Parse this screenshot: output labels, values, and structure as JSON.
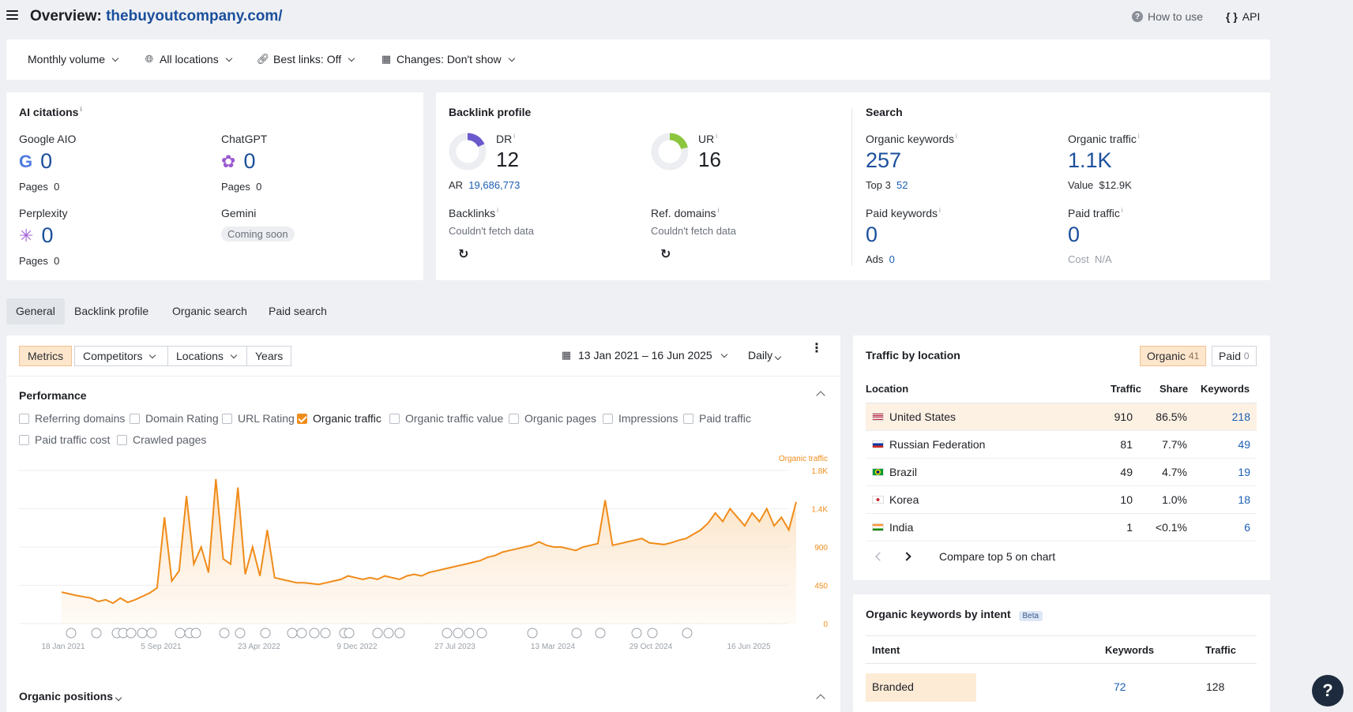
{
  "header": {
    "title_prefix": "Overview: ",
    "domain": "thebuyoutcompany.com/",
    "how_to_use": "How to use",
    "api": "API"
  },
  "filters": {
    "volume": "Monthly volume",
    "locations": "All locations",
    "best_links": "Best links: Off",
    "changes": "Changes: Don't show"
  },
  "ai_citations": {
    "title": "AI citations",
    "google": {
      "label": "Google AIO",
      "value": "0",
      "pages_label": "Pages",
      "pages": "0"
    },
    "chatgpt": {
      "label": "ChatGPT",
      "value": "0",
      "pages_label": "Pages",
      "pages": "0"
    },
    "perplexity": {
      "label": "Perplexity",
      "value": "0",
      "pages_label": "Pages",
      "pages": "0"
    },
    "gemini": {
      "label": "Gemini",
      "badge": "Coming soon"
    }
  },
  "backlink_profile": {
    "title": "Backlink profile",
    "dr_label": "DR",
    "dr": "12",
    "ar_label": "AR",
    "ar": "19,686,773",
    "ur_label": "UR",
    "ur": "16",
    "backlinks_label": "Backlinks",
    "backlinks_status": "Couldn't fetch data",
    "refdomains_label": "Ref. domains",
    "refdomains_status": "Couldn't fetch data"
  },
  "search": {
    "title": "Search",
    "organic_keywords_label": "Organic keywords",
    "organic_keywords": "257",
    "top3_label": "Top 3",
    "top3": "52",
    "organic_traffic_label": "Organic traffic",
    "organic_traffic": "1.1K",
    "value_label": "Value",
    "value": "$12.9K",
    "paid_keywords_label": "Paid keywords",
    "paid_keywords": "0",
    "ads_label": "Ads",
    "ads": "0",
    "paid_traffic_label": "Paid traffic",
    "paid_traffic": "0",
    "cost_label": "Cost",
    "cost": "N/A"
  },
  "tabs": [
    "General",
    "Backlink profile",
    "Organic search",
    "Paid search"
  ],
  "chart_controls": {
    "metrics": "Metrics",
    "competitors": "Competitors",
    "locations": "Locations",
    "years": "Years",
    "date_range": "13 Jan 2021 – 16 Jun 2025",
    "interval": "Daily"
  },
  "performance": {
    "title": "Performance",
    "checkboxes": [
      {
        "label": "Referring domains",
        "checked": false
      },
      {
        "label": "Domain Rating",
        "checked": false
      },
      {
        "label": "URL Rating",
        "checked": false
      },
      {
        "label": "Organic traffic",
        "checked": true
      },
      {
        "label": "Organic traffic value",
        "checked": false
      },
      {
        "label": "Organic pages",
        "checked": false
      },
      {
        "label": "Impressions",
        "checked": false
      },
      {
        "label": "Paid traffic",
        "checked": false
      },
      {
        "label": "Paid traffic cost",
        "checked": false
      },
      {
        "label": "Crawled pages",
        "checked": false
      }
    ]
  },
  "chart_data": {
    "type": "area",
    "series": [
      {
        "name": "Organic traffic",
        "color": "#f08c1a"
      }
    ],
    "y_ticks": [
      "1.8K",
      "1.4K",
      "900",
      "450",
      "0"
    ],
    "ylim": [
      0,
      1800
    ],
    "x_ticks": [
      "18 Jan 2021",
      "5 Sep 2021",
      "23 Apr 2022",
      "9 Dec 2022",
      "27 Jul 2023",
      "13 Mar 2024",
      "29 Oct 2024",
      "16 Jun 2025"
    ],
    "points": [
      [
        0,
        370
      ],
      [
        2,
        330
      ],
      [
        4,
        300
      ],
      [
        5,
        260
      ],
      [
        6,
        280
      ],
      [
        7,
        240
      ],
      [
        8,
        300
      ],
      [
        9,
        250
      ],
      [
        10,
        280
      ],
      [
        11,
        320
      ],
      [
        12,
        360
      ],
      [
        13,
        420
      ],
      [
        14,
        1250
      ],
      [
        15,
        500
      ],
      [
        16,
        620
      ],
      [
        17,
        1500
      ],
      [
        18,
        700
      ],
      [
        19,
        900
      ],
      [
        20,
        600
      ],
      [
        21,
        1700
      ],
      [
        22,
        760
      ],
      [
        23,
        700
      ],
      [
        24,
        1600
      ],
      [
        25,
        580
      ],
      [
        26,
        900
      ],
      [
        27,
        560
      ],
      [
        28,
        1100
      ],
      [
        29,
        540
      ],
      [
        30,
        520
      ],
      [
        31,
        500
      ],
      [
        32,
        480
      ],
      [
        33,
        480
      ],
      [
        34,
        470
      ],
      [
        35,
        460
      ],
      [
        36,
        480
      ],
      [
        37,
        500
      ],
      [
        38,
        520
      ],
      [
        39,
        560
      ],
      [
        40,
        540
      ],
      [
        41,
        520
      ],
      [
        42,
        540
      ],
      [
        43,
        520
      ],
      [
        44,
        560
      ],
      [
        45,
        540
      ],
      [
        46,
        520
      ],
      [
        47,
        560
      ],
      [
        48,
        580
      ],
      [
        49,
        560
      ],
      [
        50,
        600
      ],
      [
        51,
        620
      ],
      [
        52,
        640
      ],
      [
        53,
        660
      ],
      [
        54,
        680
      ],
      [
        55,
        700
      ],
      [
        56,
        720
      ],
      [
        57,
        740
      ],
      [
        58,
        780
      ],
      [
        59,
        800
      ],
      [
        60,
        840
      ],
      [
        61,
        860
      ],
      [
        62,
        880
      ],
      [
        63,
        900
      ],
      [
        64,
        920
      ],
      [
        65,
        960
      ],
      [
        66,
        920
      ],
      [
        67,
        900
      ],
      [
        68,
        900
      ],
      [
        69,
        880
      ],
      [
        70,
        860
      ],
      [
        71,
        900
      ],
      [
        72,
        920
      ],
      [
        73,
        940
      ],
      [
        74,
        1450
      ],
      [
        75,
        920
      ],
      [
        76,
        940
      ],
      [
        77,
        960
      ],
      [
        78,
        980
      ],
      [
        79,
        1000
      ],
      [
        80,
        950
      ],
      [
        81,
        940
      ],
      [
        82,
        930
      ],
      [
        83,
        950
      ],
      [
        84,
        980
      ],
      [
        85,
        1000
      ],
      [
        86,
        1050
      ],
      [
        87,
        1100
      ],
      [
        88,
        1180
      ],
      [
        89,
        1300
      ],
      [
        90,
        1200
      ],
      [
        91,
        1350
      ],
      [
        92,
        1250
      ],
      [
        93,
        1150
      ],
      [
        94,
        1300
      ],
      [
        95,
        1200
      ],
      [
        96,
        1350
      ],
      [
        97,
        1150
      ],
      [
        98,
        1250
      ],
      [
        99,
        1100
      ],
      [
        100,
        1430
      ]
    ]
  },
  "organic_positions": {
    "title": "Organic positions"
  },
  "traffic_by_location": {
    "title": "Traffic by location",
    "organic_label": "Organic",
    "organic_count": "41",
    "paid_label": "Paid",
    "paid_count": "0",
    "columns": [
      "Location",
      "Traffic",
      "Share",
      "Keywords"
    ],
    "rows": [
      {
        "location": "United States",
        "traffic": "910",
        "share": "86.5%",
        "keywords": "218"
      },
      {
        "location": "Russian Federation",
        "traffic": "81",
        "share": "7.7%",
        "keywords": "49"
      },
      {
        "location": "Brazil",
        "traffic": "49",
        "share": "4.7%",
        "keywords": "19"
      },
      {
        "location": "Korea",
        "traffic": "10",
        "share": "1.0%",
        "keywords": "18"
      },
      {
        "location": "India",
        "traffic": "1",
        "share": "<0.1%",
        "keywords": "6"
      }
    ],
    "compare": "Compare top 5 on chart"
  },
  "intent": {
    "title": "Organic keywords by intent",
    "badge": "Beta",
    "columns": [
      "Intent",
      "Keywords",
      "Traffic"
    ],
    "rows": [
      {
        "intent": "Branded",
        "keywords": "72",
        "traffic": "128"
      }
    ]
  },
  "help": "?"
}
